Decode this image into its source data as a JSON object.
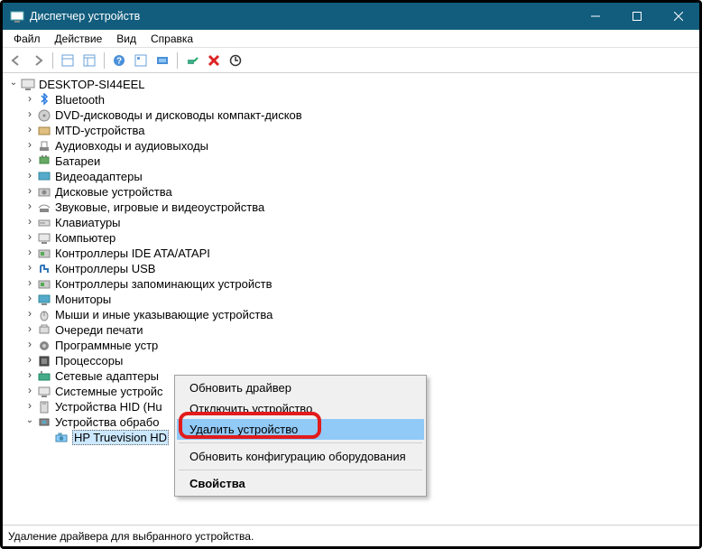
{
  "window": {
    "title": "Диспетчер устройств"
  },
  "menubar": [
    "Файл",
    "Действие",
    "Вид",
    "Справка"
  ],
  "tree": {
    "root": "DESKTOP-SI44EEL",
    "nodes": [
      "Bluetooth",
      "DVD-дисководы и дисководы компакт-дисков",
      "MTD-устройства",
      "Аудиовходы и аудиовыходы",
      "Батареи",
      "Видеоадаптеры",
      "Дисковые устройства",
      "Звуковые, игровые и видеоустройства",
      "Клавиатуры",
      "Компьютер",
      "Контроллеры IDE ATA/ATAPI",
      "Контроллеры USB",
      "Контроллеры запоминающих устройств",
      "Мониторы",
      "Мыши и иные указывающие устройства",
      "Очереди печати",
      "Программные устр",
      "Процессоры",
      "Сетевые адаптеры",
      "Системные устройс",
      "Устройства HID (Hu",
      "Устройства обрабо"
    ],
    "child": "HP Truevision HD"
  },
  "context_menu": {
    "items": [
      "Обновить драйвер",
      "Отключить устройство",
      "Удалить устройство",
      "Обновить конфигурацию оборудования",
      "Свойства"
    ],
    "highlighted_index": 2
  },
  "statusbar": "Удаление драйвера для выбранного устройства."
}
